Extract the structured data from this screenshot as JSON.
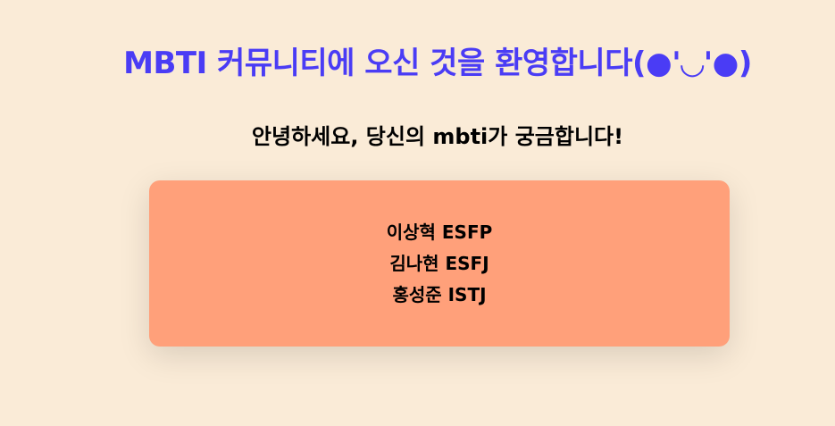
{
  "header": {
    "title": "MBTI 커뮤니티에 오신 것을 환영합니다(●'◡'●)",
    "subtitle": "안녕하세요, 당신의 mbti가 궁금합니다!"
  },
  "members": [
    "이상혁 ESFP",
    "김나현 ESFJ",
    "홍성준 ISTJ"
  ]
}
